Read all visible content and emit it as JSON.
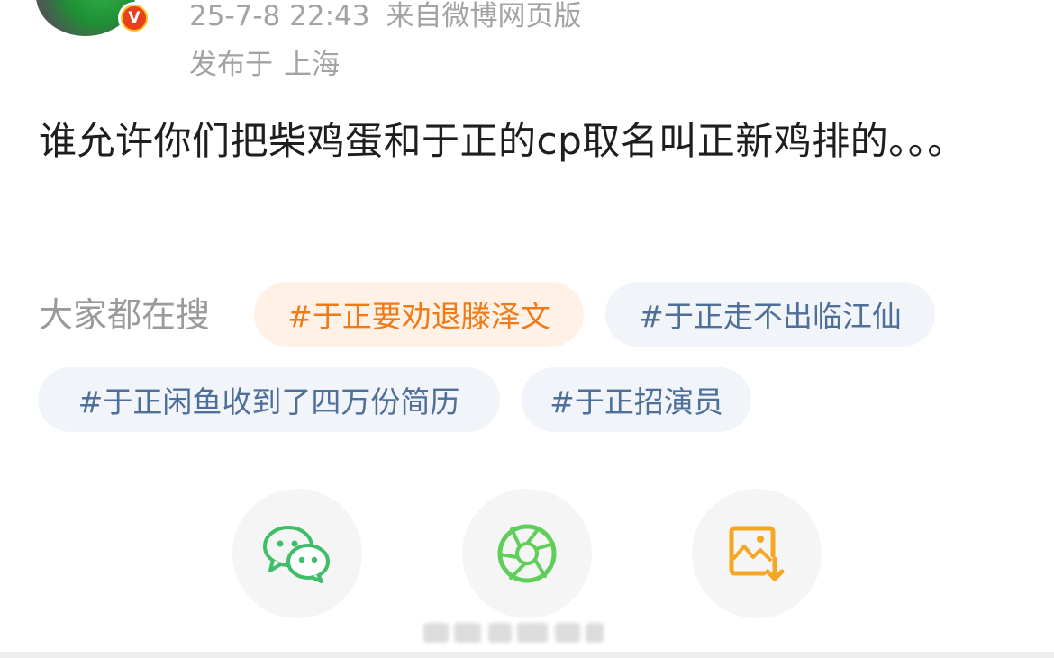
{
  "header": {
    "timestamp": "25-7-8 22:43",
    "source": "来自微博网页版",
    "location_prefix": "发布于",
    "location": "上海",
    "verified_mark": "V"
  },
  "post": {
    "text": "谁允许你们把柴鸡蛋和于正的cp取名叫正新鸡排的。。。"
  },
  "hot_search": {
    "label": "大家都在搜",
    "tags": [
      {
        "text": "#于正要劝退滕泽文",
        "style": "hot"
      },
      {
        "text": "#于正走不出临江仙",
        "style": "normal"
      },
      {
        "text": "#于正闲鱼收到了四万份简历",
        "style": "normal"
      },
      {
        "text": "#于正招演员",
        "style": "normal"
      }
    ]
  },
  "share": {
    "buttons": [
      {
        "icon": "wechat-icon",
        "color": "#3fbe6a"
      },
      {
        "icon": "moments-icon",
        "color": "#5fcf5a"
      },
      {
        "icon": "save-image-icon",
        "color": "#f5a623"
      }
    ]
  },
  "colors": {
    "hot_tag_bg": "#fff1e5",
    "hot_tag_text": "#f07a16",
    "tag_bg": "#f1f4f8",
    "tag_text": "#4d6f99",
    "meta_text": "#a3a3a3"
  }
}
